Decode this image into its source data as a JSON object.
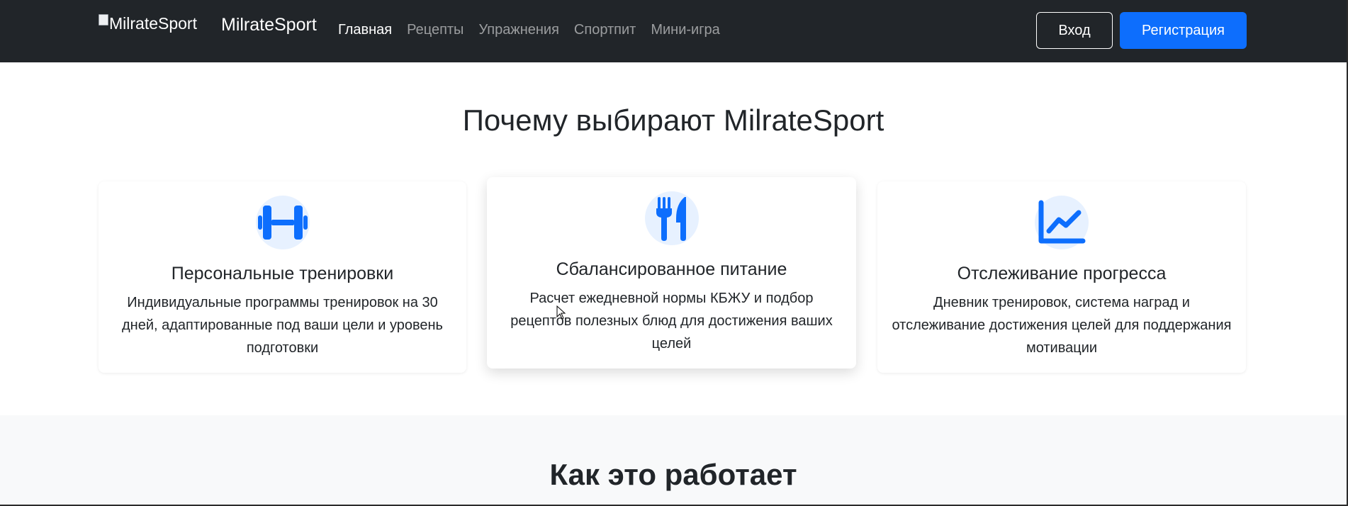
{
  "navbar": {
    "logo_alt": "MilrateSport",
    "brand": "MilrateSport",
    "links": [
      {
        "label": "Главная",
        "active": true
      },
      {
        "label": "Рецепты",
        "active": false
      },
      {
        "label": "Упражнения",
        "active": false
      },
      {
        "label": "Спортпит",
        "active": false
      },
      {
        "label": "Мини-игра",
        "active": false
      }
    ],
    "login_label": "Вход",
    "register_label": "Регистрация"
  },
  "features": {
    "title": "Почему выбирают MilrateSport",
    "cards": [
      {
        "icon": "dumbbell-icon",
        "title": "Персональные тренировки",
        "lines": [
          "Индивидуальные программы тренировок на 30",
          "дней, адаптированные под ваши цели и уровень",
          "подготовки"
        ]
      },
      {
        "icon": "utensils-icon",
        "title": "Сбалансированное питание",
        "lines": [
          "Расчет ежедневной нормы КБЖУ и подбор",
          "рецептов полезных блюд для достижения ваших",
          "целей"
        ]
      },
      {
        "icon": "chart-line-icon",
        "title": "Отслеживание прогресса",
        "lines": [
          "Дневник тренировок, система наград и",
          "отслеживание достижения целей для поддержания",
          "мотивации"
        ]
      }
    ]
  },
  "how_it_works": {
    "title": "Как это работает"
  },
  "colors": {
    "navbar_bg": "#212529",
    "accent": "#0d6efd",
    "icon_circle_bg": "#e7f1ff",
    "section_alt_bg": "#f8f9fa"
  }
}
